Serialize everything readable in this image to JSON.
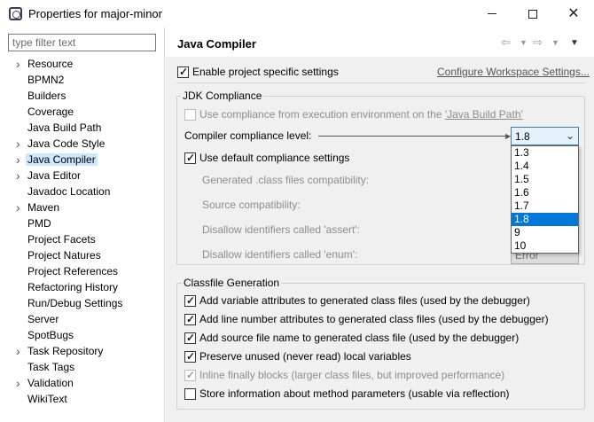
{
  "window": {
    "title": "Properties for major-minor"
  },
  "filter": {
    "placeholder": "type filter text"
  },
  "tree": [
    {
      "label": "Resource",
      "expandable": true
    },
    {
      "label": "BPMN2",
      "expandable": false
    },
    {
      "label": "Builders",
      "expandable": false
    },
    {
      "label": "Coverage",
      "expandable": false
    },
    {
      "label": "Java Build Path",
      "expandable": false
    },
    {
      "label": "Java Code Style",
      "expandable": true
    },
    {
      "label": "Java Compiler",
      "expandable": true,
      "selected": true
    },
    {
      "label": "Java Editor",
      "expandable": true
    },
    {
      "label": "Javadoc Location",
      "expandable": false
    },
    {
      "label": "Maven",
      "expandable": true
    },
    {
      "label": "PMD",
      "expandable": false
    },
    {
      "label": "Project Facets",
      "expandable": false
    },
    {
      "label": "Project Natures",
      "expandable": false
    },
    {
      "label": "Project References",
      "expandable": false
    },
    {
      "label": "Refactoring History",
      "expandable": false
    },
    {
      "label": "Run/Debug Settings",
      "expandable": false
    },
    {
      "label": "Server",
      "expandable": false
    },
    {
      "label": "SpotBugs",
      "expandable": false
    },
    {
      "label": "Task Repository",
      "expandable": true
    },
    {
      "label": "Task Tags",
      "expandable": false
    },
    {
      "label": "Validation",
      "expandable": true
    },
    {
      "label": "WikiText",
      "expandable": false
    }
  ],
  "page": {
    "title": "Java Compiler",
    "enable_specific": {
      "label": "Enable project specific settings",
      "checked": true
    },
    "configure_link": "Configure Workspace Settings...",
    "jdk": {
      "group_title": "JDK Compliance",
      "use_env": {
        "label_pre": "Use compliance from execution environment on the ",
        "label_link": "'Java Build Path'",
        "checked": false
      },
      "level_label": "Compiler compliance level:",
      "level_value": "1.8",
      "level_options": [
        "1.3",
        "1.4",
        "1.5",
        "1.6",
        "1.7",
        "1.8",
        "9",
        "10"
      ],
      "use_default": {
        "label": "Use default compliance settings",
        "checked": true
      },
      "generated_label": "Generated .class files compatibility:",
      "source_label": "Source compatibility:",
      "assert_label": "Disallow identifiers called 'assert':",
      "enum_label": "Disallow identifiers called 'enum':",
      "enum_value": "Error"
    },
    "classfile": {
      "group_title": "Classfile Generation",
      "options": [
        {
          "label": "Add variable attributes to generated class files (used by the debugger)",
          "checked": true,
          "disabled": false
        },
        {
          "label": "Add line number attributes to generated class files (used by the debugger)",
          "checked": true,
          "disabled": false
        },
        {
          "label": "Add source file name to generated class file (used by the debugger)",
          "checked": true,
          "disabled": false
        },
        {
          "label": "Preserve unused (never read) local variables",
          "checked": true,
          "disabled": false
        },
        {
          "label": "Inline finally blocks (larger class files, but improved performance)",
          "checked": true,
          "disabled": true
        },
        {
          "label": "Store information about method parameters (usable via reflection)",
          "checked": false,
          "disabled": false
        }
      ]
    }
  }
}
